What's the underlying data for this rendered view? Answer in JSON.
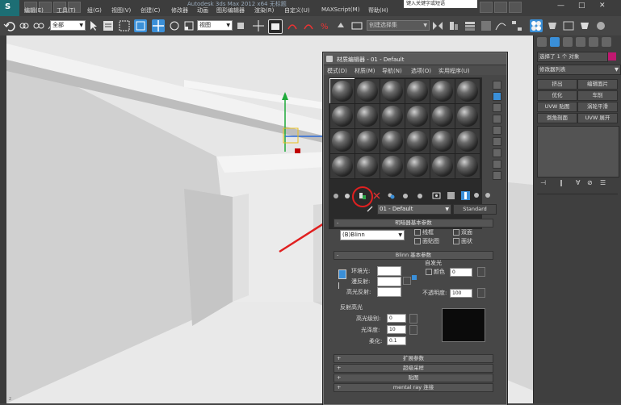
{
  "app": {
    "title_text": "Autodesk 3ds Max 2012 x64  无标题",
    "help_search_placeholder": "键入关键字或短语"
  },
  "menubar": {
    "items": [
      "编辑(E)",
      "工具(T)",
      "组(G)",
      "视图(V)",
      "创建(C)",
      "修改器",
      "动画",
      "图形编辑器",
      "渲染(R)",
      "自定义(U)",
      "MAXScript(M)",
      "帮助(H)"
    ]
  },
  "toolbar": {
    "selection_filter": "全部",
    "reference_coord": "视图",
    "named_selection": "创建选择集"
  },
  "command_panel": {
    "object_name": "选择了 1 个 对象",
    "modifier_list": "修改器列表",
    "buttons": [
      [
        "挤出",
        "编辑面片"
      ],
      [
        "优化",
        "车削"
      ],
      [
        "UVW 贴图",
        "涡轮平滑"
      ],
      [
        "倒角剖面",
        "UVW 展开"
      ]
    ]
  },
  "material_editor": {
    "title": "材质编辑器 - 01 - Default",
    "menu": [
      "模式(D)",
      "材质(M)",
      "导航(N)",
      "选项(O)",
      "实用程序(U)"
    ],
    "material_name": "01 - Default",
    "material_type": "Standard",
    "rollouts": {
      "shader_basic": "明暗器基本参数",
      "blinn_basic": "Blinn 基本参数",
      "extended": "扩展参数",
      "supersampling": "超级采样",
      "maps": "贴图",
      "mental_ray": "mental ray 连接"
    },
    "shader": {
      "type": "(B)Blinn",
      "wire": "线框",
      "two_sided": "双面",
      "face_map": "面贴图",
      "faceted": "面状"
    },
    "blinn": {
      "ambient": "环境光:",
      "diffuse": "漫反射:",
      "specular": "高光反射:",
      "self_illum": "自发光",
      "color_label": "颜色",
      "color_value": "0",
      "opacity_label": "不透明度:",
      "opacity_value": "100"
    },
    "highlights": {
      "group": "反射高光",
      "level_label": "高光级别:",
      "level_value": "0",
      "gloss_label": "光泽度:",
      "gloss_value": "10",
      "soften_label": "柔化:",
      "soften_value": "0.1"
    }
  },
  "colors": {
    "annotation_red": "#e02020",
    "accent_blue": "#3a8fd8"
  }
}
